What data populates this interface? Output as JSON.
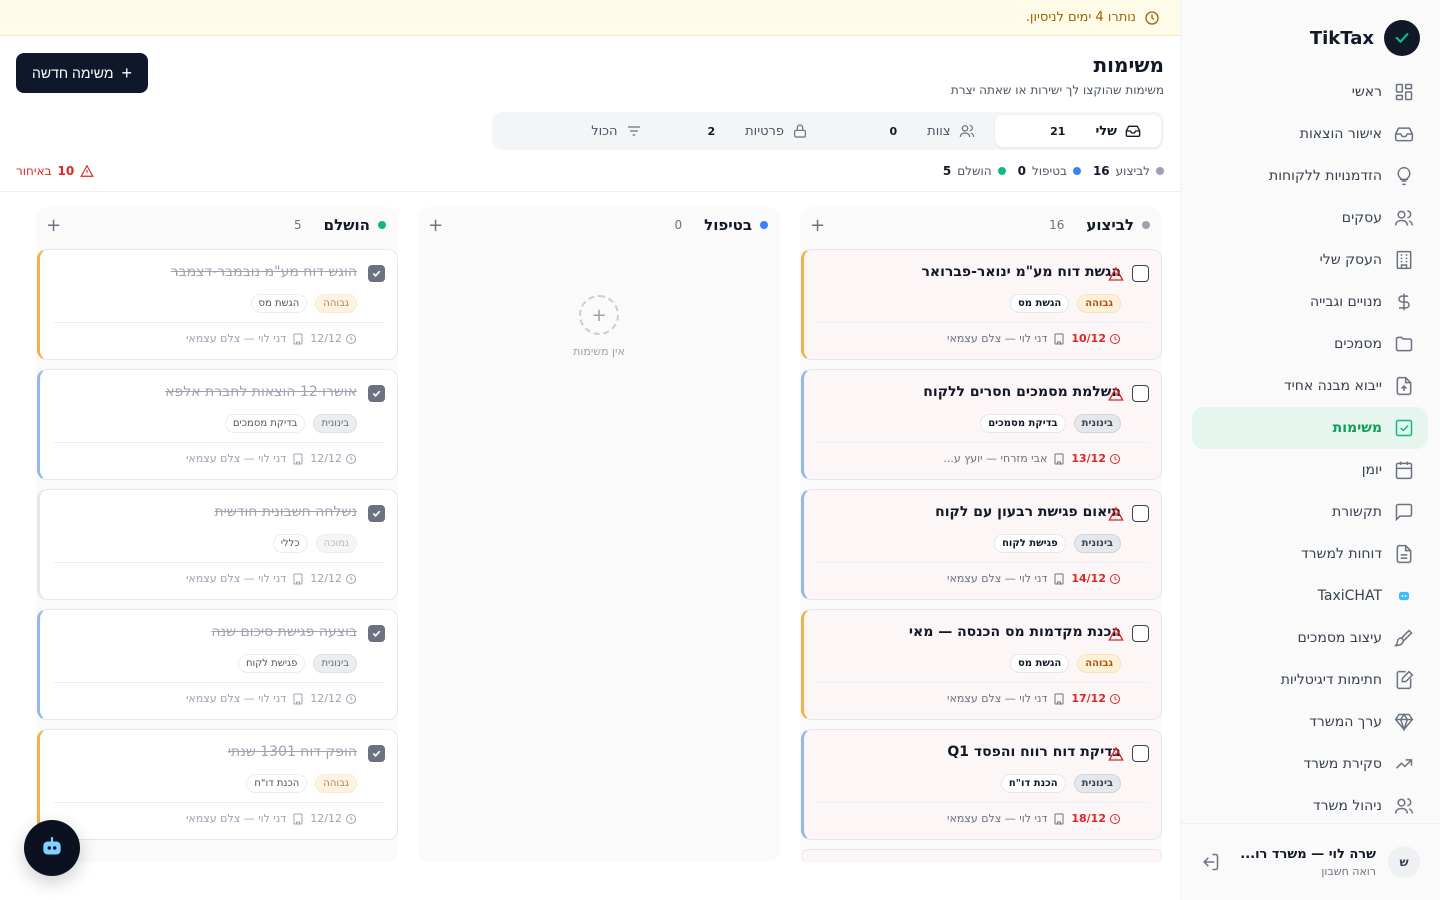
{
  "app": {
    "name": "TikTax"
  },
  "trial": {
    "text": "נותרו 4 ימים לניסיון."
  },
  "nav": [
    {
      "label": "ראשי",
      "icon": "grid-icon"
    },
    {
      "label": "אישור הוצאות",
      "icon": "inbox-icon"
    },
    {
      "label": "הזדמנויות ללקוחות",
      "icon": "lightbulb-icon"
    },
    {
      "label": "עסקים",
      "icon": "users-icon"
    },
    {
      "label": "העסק שלי",
      "icon": "building-icon"
    },
    {
      "label": "מנויים וגבייה",
      "icon": "dollar-icon"
    },
    {
      "label": "מסמכים",
      "icon": "folder-icon"
    },
    {
      "label": "ייבוא מבנה אחיד",
      "icon": "file-upload-icon"
    },
    {
      "label": "משימות",
      "icon": "check-square-icon",
      "active": true
    },
    {
      "label": "יומן",
      "icon": "calendar-icon"
    },
    {
      "label": "תקשורת",
      "icon": "message-icon"
    },
    {
      "label": "דוחות למשרד",
      "icon": "report-icon"
    },
    {
      "label": "TaxiCHAT",
      "icon": "bot-icon"
    },
    {
      "label": "עיצוב מסמכים",
      "icon": "brush-icon"
    },
    {
      "label": "חתימות דיגיטליות",
      "icon": "signature-icon"
    },
    {
      "label": "ערך המשרד",
      "icon": "diamond-icon"
    },
    {
      "label": "סקירת משרד",
      "icon": "trend-icon"
    },
    {
      "label": "ניהול משרד",
      "icon": "team-icon"
    }
  ],
  "user": {
    "initial": "ש",
    "name": "שרה לוי — משרד רו...",
    "role": "רואה חשבון"
  },
  "page": {
    "title": "משימות",
    "subtitle": "משימות שהוקצו לך ישירות או שאתה יצרת",
    "new_button": "משימה חדשה"
  },
  "tabs": [
    {
      "label": "שלי",
      "count": "21",
      "icon": "inbox-icon"
    },
    {
      "label": "צוות",
      "count": "0",
      "icon": "users-icon"
    },
    {
      "label": "פרטיות",
      "count": "2",
      "icon": "lock-icon"
    },
    {
      "label": "הכול",
      "count": "",
      "icon": "filter-icon"
    }
  ],
  "summary": [
    {
      "label": "לביצוע",
      "count": "16",
      "color": "#9ca3af"
    },
    {
      "label": "בטיפול",
      "count": "0",
      "color": "#3b82f6"
    },
    {
      "label": "הושלם",
      "count": "5",
      "color": "#10b981"
    }
  ],
  "overdue": {
    "count": "10",
    "label": "באיחור"
  },
  "columns": {
    "todo": {
      "title": "לביצוע",
      "count": "16",
      "color": "#9ca3af",
      "cards": [
        {
          "title": "הגשת דוח מע\"מ ינואר-פברואר",
          "priority": "גבוהה",
          "category": "הגשת מס",
          "due": "10/12",
          "client": "דני לוי — צלם עצמאי"
        },
        {
          "title": "השלמת מסמכים חסרים ללקוח",
          "priority": "בינונית",
          "category": "בדיקת מסמכים",
          "due": "13/12",
          "client": "אבי מזרחי — יועץ ע..."
        },
        {
          "title": "תיאום פגישת רבעון עם לקוח",
          "priority": "בינונית",
          "category": "פגישת לקוח",
          "due": "14/12",
          "client": "דני לוי — צלם עצמאי"
        },
        {
          "title": "הכנת מקדמות מס הכנסה — מאי",
          "priority": "גבוהה",
          "category": "הגשת מס",
          "due": "17/12",
          "client": "דני לוי — צלם עצמאי"
        },
        {
          "title": "בדיקת דוח רווח והפסד Q1",
          "priority": "בינונית",
          "category": "הכנת דו\"ח",
          "due": "18/12",
          "client": "דני לוי — צלם עצמאי"
        }
      ]
    },
    "progress": {
      "title": "בטיפול",
      "count": "0",
      "color": "#3b82f6",
      "empty": "אין משימות"
    },
    "done": {
      "title": "הושלם",
      "count": "5",
      "color": "#10b981",
      "cards": [
        {
          "title": "הוגש דוח מע\"מ נובמבר-דצמבר",
          "priority": "גבוהה",
          "category": "הגשת מס",
          "due": "12/12",
          "client": "דני לוי — צלם עצמאי"
        },
        {
          "title": "אושרו 12 הוצאות לחברת אלפא",
          "priority": "בינונית",
          "category": "בדיקת מסמכים",
          "due": "12/12",
          "client": "דני לוי — צלם עצמאי"
        },
        {
          "title": "נשלחה חשבונית חודשית",
          "priority": "נמוכה",
          "category": "כללי",
          "due": "12/12",
          "client": "דני לוי — צלם עצמאי"
        },
        {
          "title": "בוצעה פגישת סיכום שנה",
          "priority": "בינונית",
          "category": "פגישת לקוח",
          "due": "12/12",
          "client": "דני לוי — צלם עצמאי"
        },
        {
          "title": "הופק דוח 1301 שנתי",
          "priority": "גבוהה",
          "category": "הכנת דו\"ח",
          "due": "12/12",
          "client": "דני לוי — צלם עצמאי"
        }
      ]
    }
  }
}
